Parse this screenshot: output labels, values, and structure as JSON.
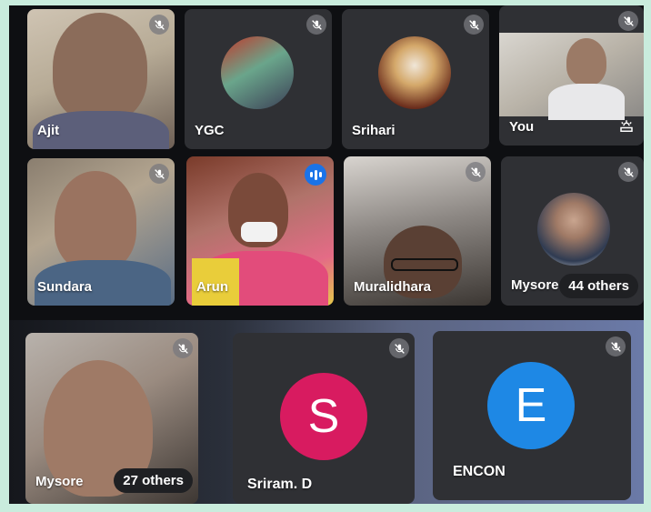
{
  "participants_top": [
    {
      "name": "Ajit",
      "muted": true
    },
    {
      "name": "YGC",
      "muted": true
    },
    {
      "name": "Srihari",
      "muted": true
    },
    {
      "name": "You",
      "muted": true
    },
    {
      "name": "Sundara",
      "muted": true
    },
    {
      "name": "Arun",
      "muted": false,
      "speaking": true
    },
    {
      "name": "Muralidhara",
      "muted": true
    },
    {
      "name": "Mysore",
      "muted": true,
      "others_label": "44 others"
    }
  ],
  "participants_bottom": [
    {
      "name": "Mysore",
      "muted": true,
      "others_label": "27 others"
    },
    {
      "name": "Sriram. D",
      "muted": true,
      "initial": "S",
      "avatar_color": "#d81b60"
    },
    {
      "name": "ENCON",
      "muted": true,
      "initial": "E",
      "avatar_color": "#1e88e5"
    }
  ],
  "icons": {
    "mic_off": "mic-off-icon",
    "speaking": "speaking-indicator-icon",
    "you_options": "you-options-icon"
  }
}
